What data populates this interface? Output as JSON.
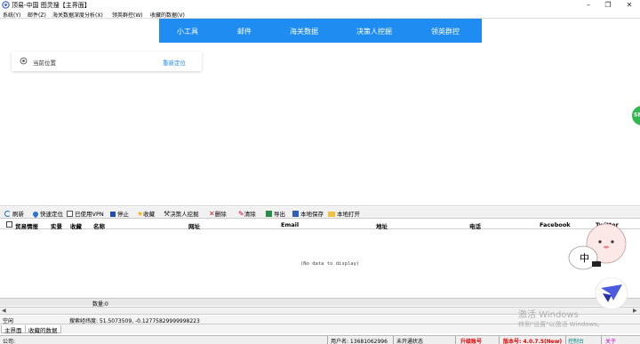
{
  "window": {
    "title": "顶易-中国 图灵搜【主界面】",
    "minimize": "–",
    "maximize": "❐",
    "close": "✕"
  },
  "menu": [
    "系统(Y)",
    "邮件(Z)",
    "海关数据深度分析(X)",
    "领英群控(W)",
    "收藏的数据(V)"
  ],
  "nav": [
    "小工具",
    "邮件",
    "海关数据",
    "决策人挖掘",
    "领英群控"
  ],
  "location": {
    "label": "当前位置",
    "button": "重新定位"
  },
  "side_button": "SE",
  "toolbar": [
    "刷新",
    "快速定位",
    "已使用VPN",
    "停止",
    "收藏",
    "决策人挖掘",
    "删除",
    "清除",
    "导出",
    "本地保存",
    "本地打开"
  ],
  "columns": [
    "贸易情报",
    "实景",
    "收藏",
    "名称",
    "网址",
    "Email",
    "地址",
    "电话",
    "Facebook",
    "Twitter"
  ],
  "grid": {
    "empty_text": "(No data to display)",
    "count_label": "数量:0"
  },
  "info": {
    "left": "空闲",
    "coords": "搜索经纬度: 51.5073509, -0.12775829999998223"
  },
  "tabs": [
    "主界面",
    "收藏的数据"
  ],
  "status": {
    "company": "公司:",
    "phone": "用户名: 13681062996",
    "link_status": "未开通状态",
    "upgrade": "升级账号",
    "version": "版本号: 4.0.7.5(New)",
    "console": "控制台",
    "about": "关于"
  },
  "watermark": {
    "line1": "激活 Windows",
    "line2": "转到\"设置\"以激活 Windows。"
  },
  "mascot_text": "中",
  "colors": {
    "nav_blue": "#1e8cf0",
    "side_green": "#2fb84f",
    "upgrade_red": "#e00000",
    "version_red": "#e00000",
    "console_teal": "#008080"
  }
}
